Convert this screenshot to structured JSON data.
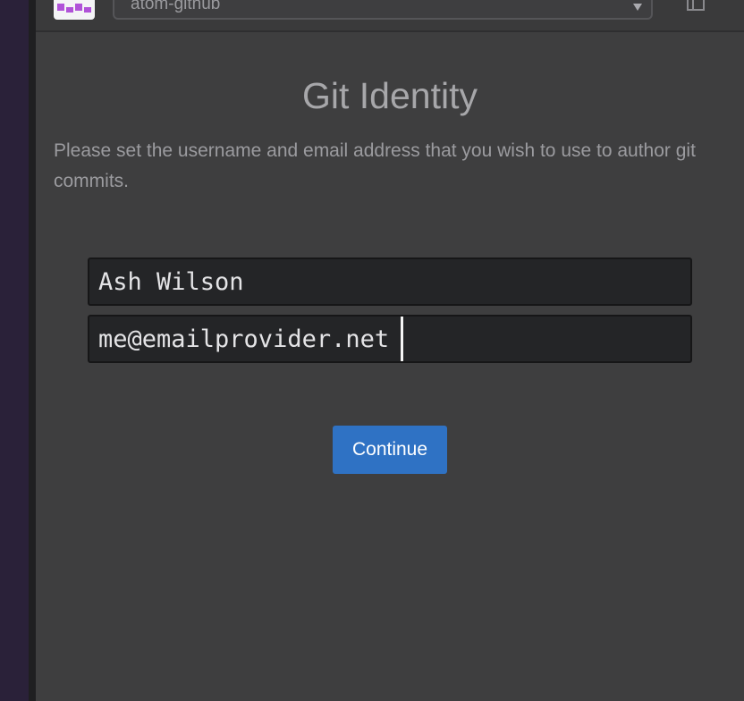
{
  "header": {
    "repo_selector_value": "atom-github"
  },
  "identity": {
    "title": "Git Identity",
    "description": "Please set the username and email address that you wish to use to author git commits.",
    "name_value": "Ash Wilson",
    "email_value": "me@emailprovider.net",
    "continue_label": "Continue"
  },
  "colors": {
    "accent": "#2f72c4",
    "panel_bg": "#3e3e3f",
    "rail_bg": "#2a2139"
  },
  "icons": {
    "avatar": "user-avatar-icon",
    "repo_dropdown": "chevron-down-icon",
    "topbar_button": "panel-icon"
  }
}
